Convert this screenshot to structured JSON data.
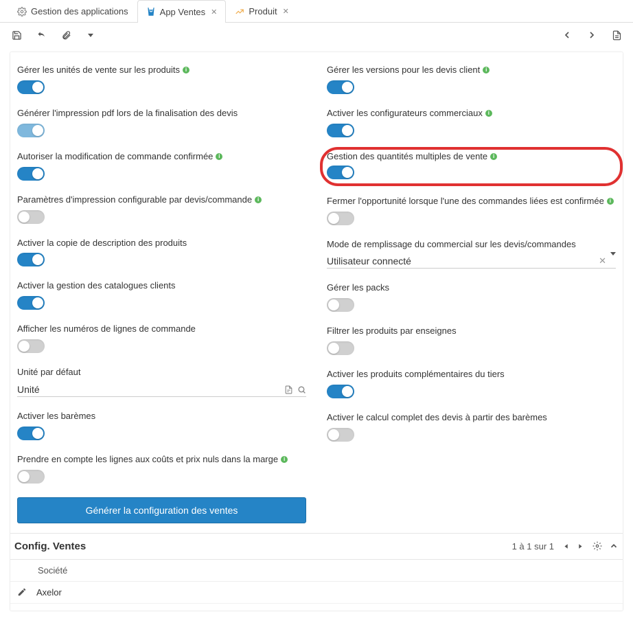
{
  "tabs": [
    {
      "label": "Gestion des applications"
    },
    {
      "label": "App Ventes"
    },
    {
      "label": "Produit"
    }
  ],
  "left": [
    {
      "label": "Gérer les unités de vente sur les produits",
      "info": true,
      "on": true
    },
    {
      "label": "Générer l'impression pdf lors de la finalisation des devis",
      "info": false,
      "on": "semi"
    },
    {
      "label": "Autoriser la modification de commande confirmée",
      "info": true,
      "on": true
    },
    {
      "label": "Paramètres d'impression configurable par devis/commande",
      "info": true,
      "on": false
    },
    {
      "label": "Activer la copie de description des produits",
      "info": false,
      "on": true
    },
    {
      "label": "Activer la gestion des catalogues clients",
      "info": false,
      "on": true
    },
    {
      "label": "Afficher les numéros de lignes de commande",
      "info": false,
      "on": false
    },
    {
      "label": "Unité par défaut",
      "type": "input",
      "value": "Unité"
    },
    {
      "label": "Activer les barèmes",
      "info": false,
      "on": true
    },
    {
      "label": "Prendre en compte les lignes aux coûts et prix nuls dans la marge",
      "info": true,
      "on": false
    }
  ],
  "right": [
    {
      "label": "Gérer les versions pour les devis client",
      "info": true,
      "on": true
    },
    {
      "label": "Activer les configurateurs commerciaux",
      "info": true,
      "on": true
    },
    {
      "label": "Gestion des quantités multiples de vente",
      "info": true,
      "on": true,
      "highlight": true
    },
    {
      "label": "Fermer l'opportunité lorsque l'une des commandes liées est confirmée",
      "info": true,
      "on": false
    },
    {
      "label": "Mode de remplissage du commercial sur les devis/commandes",
      "type": "select",
      "value": "Utilisateur connecté"
    },
    {
      "label": "Gérer les packs",
      "info": false,
      "on": false
    },
    {
      "label": "Filtrer les produits par enseignes",
      "info": false,
      "on": false
    },
    {
      "label": "Activer les produits complémentaires du tiers",
      "info": false,
      "on": true
    },
    {
      "label": "Activer le calcul complet des devis à partir des barèmes",
      "info": false,
      "on": false
    }
  ],
  "button": "Générer la configuration des ventes",
  "section": {
    "title": "Config. Ventes",
    "pager": "1 à 1 sur 1",
    "column": "Société",
    "rows": [
      {
        "value": "Axelor"
      }
    ]
  }
}
